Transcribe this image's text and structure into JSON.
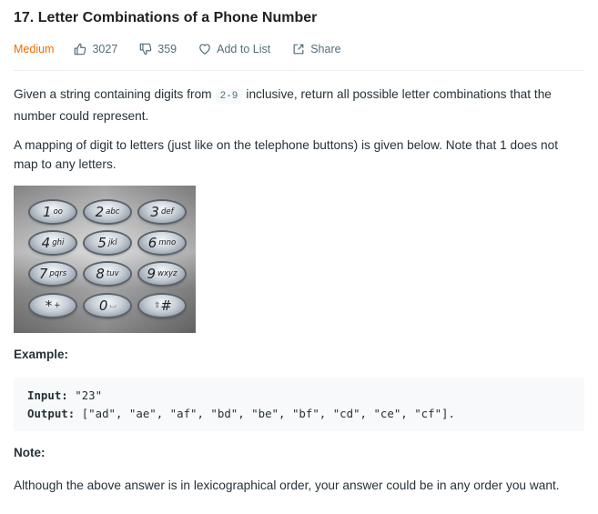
{
  "problem": {
    "title": "17. Letter Combinations of a Phone Number",
    "difficulty": "Medium",
    "likes": "3027",
    "dislikes": "359",
    "add_to_list": "Add to List",
    "share": "Share"
  },
  "description": {
    "p1_before": "Given a string containing digits from",
    "p1_code": "2-9",
    "p1_after": "inclusive, return all possible letter combinations that the number could represent.",
    "p2": "A mapping of digit to letters (just like on the telephone buttons) is given below. Note that 1 does not map to any letters."
  },
  "keypad": {
    "keys": [
      {
        "digit": "1",
        "letters": "oo"
      },
      {
        "digit": "2",
        "letters": "abc"
      },
      {
        "digit": "3",
        "letters": "def"
      },
      {
        "digit": "4",
        "letters": "ghi"
      },
      {
        "digit": "5",
        "letters": "jkl"
      },
      {
        "digit": "6",
        "letters": "mno"
      },
      {
        "digit": "7",
        "letters": "pqrs"
      },
      {
        "digit": "8",
        "letters": "tuv"
      },
      {
        "digit": "9",
        "letters": "wxyz"
      },
      {
        "digit": "*",
        "letters": "+"
      },
      {
        "digit": "0",
        "letters": "⌴"
      },
      {
        "digit": "#",
        "letters": "⇧"
      }
    ]
  },
  "example": {
    "label": "Example:",
    "input_label": "Input:",
    "input_value": "\"23\"",
    "output_label": "Output:",
    "output_value": "[\"ad\", \"ae\", \"af\", \"bd\", \"be\", \"bf\", \"cd\", \"ce\", \"cf\"]."
  },
  "note": {
    "label": "Note:",
    "text": "Although the above answer is in lexicographical order, your answer could be in any order you want."
  },
  "colors": {
    "difficulty_medium": "#ef6c00",
    "text": "#263238",
    "meta": "#546e7a",
    "code_bg": "#f7f9fa"
  }
}
